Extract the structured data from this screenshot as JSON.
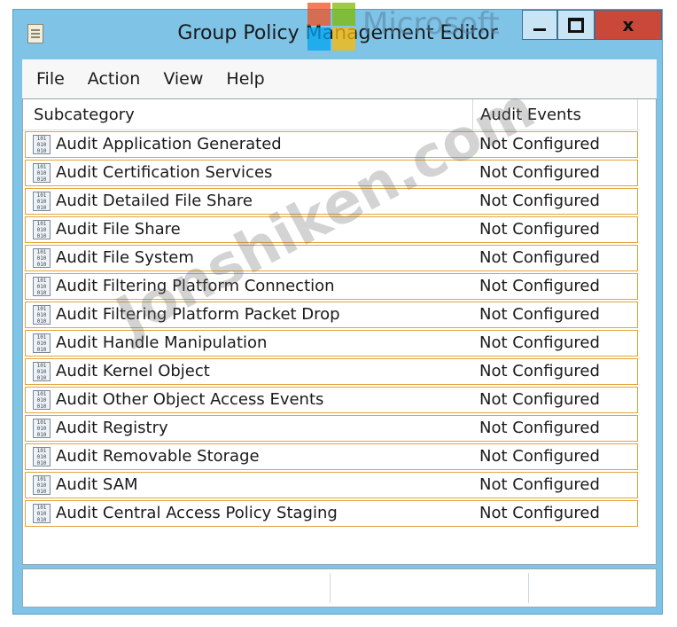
{
  "window": {
    "title": "Group Policy Management Editor",
    "minimize_label": "",
    "maximize_label": "",
    "close_label": "x"
  },
  "menu": [
    "File",
    "Action",
    "View",
    "Help"
  ],
  "table": {
    "headers": [
      "Subcategory",
      "Audit Events"
    ],
    "rows": [
      {
        "name": "Audit Application Generated",
        "value": "Not Configured"
      },
      {
        "name": "Audit Certification Services",
        "value": "Not Configured"
      },
      {
        "name": "Audit Detailed File Share",
        "value": "Not Configured"
      },
      {
        "name": "Audit File Share",
        "value": "Not Configured"
      },
      {
        "name": "Audit File System",
        "value": "Not Configured"
      },
      {
        "name": "Audit Filtering Platform Connection",
        "value": "Not Configured"
      },
      {
        "name": "Audit Filtering Platform Packet Drop",
        "value": "Not Configured"
      },
      {
        "name": "Audit Handle Manipulation",
        "value": "Not Configured"
      },
      {
        "name": "Audit Kernel Object",
        "value": "Not Configured"
      },
      {
        "name": "Audit Other Object Access Events",
        "value": "Not Configured"
      },
      {
        "name": "Audit Registry",
        "value": "Not Configured"
      },
      {
        "name": "Audit Removable Storage",
        "value": "Not Configured"
      },
      {
        "name": "Audit SAM",
        "value": "Not Configured"
      },
      {
        "name": "Audit Central Access Policy Staging",
        "value": "Not Configured"
      }
    ]
  },
  "watermarks": {
    "brand": "Microsoft",
    "site": "Jonshiken.com"
  },
  "icons": {
    "app": "policy-document-icon",
    "row": "audit-policy-icon"
  },
  "colors": {
    "window_frame": "#7fc3e6",
    "close_button": "#c9483a",
    "row_border": "#e3a33c"
  }
}
